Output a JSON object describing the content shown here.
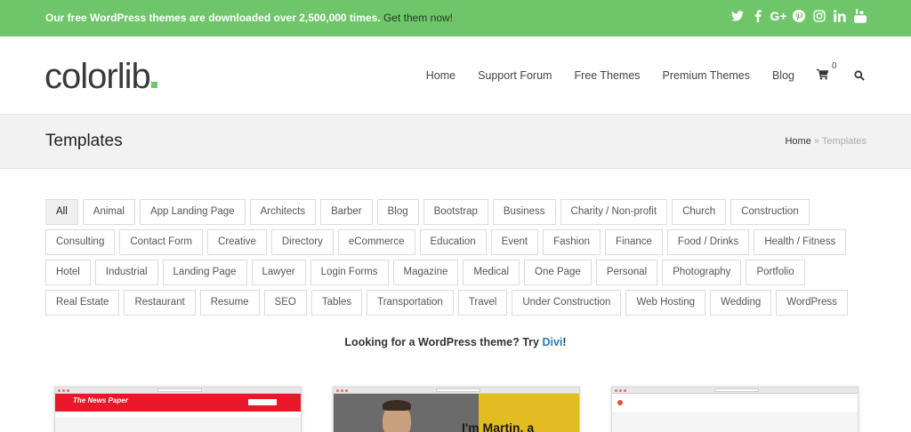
{
  "topbar": {
    "message": "Our free WordPress themes are downloaded over 2,500,000 times.",
    "cta": "Get them now!",
    "social_icons": [
      "twitter-icon",
      "facebook-icon",
      "google-plus-icon",
      "pinterest-icon",
      "instagram-icon",
      "linkedin-icon",
      "youtube-icon"
    ]
  },
  "header": {
    "logo": "colorlib",
    "nav": [
      "Home",
      "Support Forum",
      "Free Themes",
      "Premium Themes",
      "Blog"
    ],
    "cart_count": "0"
  },
  "band": {
    "title": "Templates",
    "breadcrumb_home": "Home",
    "breadcrumb_sep": " » ",
    "breadcrumb_current": "Templates"
  },
  "tags": [
    "All",
    "Animal",
    "App Landing Page",
    "Architects",
    "Barber",
    "Blog",
    "Bootstrap",
    "Business",
    "Charity / Non-profit",
    "Church",
    "Construction",
    "Consulting",
    "Contact Form",
    "Creative",
    "Directory",
    "eCommerce",
    "Education",
    "Event",
    "Fashion",
    "Finance",
    "Food / Drinks",
    "Health / Fitness",
    "Hotel",
    "Industrial",
    "Landing Page",
    "Lawyer",
    "Login Forms",
    "Magazine",
    "Medical",
    "One Page",
    "Personal",
    "Photography",
    "Portfolio",
    "Real Estate",
    "Restaurant",
    "Resume",
    "SEO",
    "Tables",
    "Transportation",
    "Travel",
    "Under Construction",
    "Web Hosting",
    "Wedding",
    "WordPress"
  ],
  "active_tag": "All",
  "promo": {
    "text": "Looking for a WordPress theme? Try ",
    "link": "Divi",
    "suffix": "!"
  },
  "thumbnails": {
    "t1_title": "The News Paper",
    "t2_text": "I'm Martin, a"
  },
  "colors": {
    "brand_green": "#6fc66a",
    "link_blue": "#2a7ab8",
    "news_red": "#e8182a",
    "martin_yellow": "#e3bb23"
  }
}
